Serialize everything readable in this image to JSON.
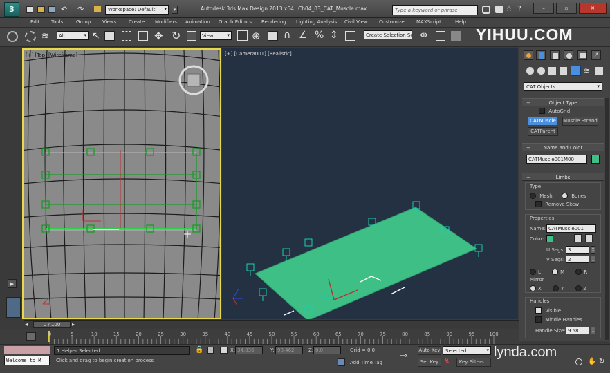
{
  "titlebar": {
    "workspace": "Workspace: Default",
    "title": "Autodesk 3ds Max Design 2013 x64",
    "file": "Ch04_03_CAT_Muscle.max",
    "search_placeholder": "Type a keyword or phrase"
  },
  "menu": [
    "Edit",
    "Tools",
    "Group",
    "Views",
    "Create",
    "Modifiers",
    "Animation",
    "Graph Editors",
    "Rendering",
    "Lighting Analysis",
    "Civil View",
    "Customize",
    "MAXScript",
    "Help"
  ],
  "toolbar": {
    "filter": "All",
    "refcoord": "View",
    "selection_set": "Create Selection Se"
  },
  "viewports": {
    "left_label": "[+] [Top] [Wireframe]",
    "right_label": "[+] [Camera001] [Realistic]"
  },
  "command_panel": {
    "category": "CAT Objects",
    "object_type": {
      "title": "Object Type",
      "autogrid": "AutoGrid",
      "buttons": [
        "CATMuscle",
        "Muscle Strand",
        "CATParent"
      ]
    },
    "name_color": {
      "title": "Name and Color",
      "name": "CATMuscle001M00",
      "color": "#3dbf86"
    },
    "limbs": {
      "title": "Limbs",
      "type_label": "Type",
      "mesh": "Mesh",
      "bones": "Bones",
      "remove_skew": "Remove Skew",
      "properties_label": "Properties",
      "name_label": "Name:",
      "name_value": "CATMuscle001",
      "color_label": "Color:",
      "usegs_label": "U Segs:",
      "usegs_value": "3",
      "vsegs_label": "V Segs:",
      "vsegs_value": "2",
      "lmr": [
        "L",
        "M",
        "R"
      ],
      "mirror_label": "Mirror",
      "xyz": [
        "X",
        "Y",
        "Z"
      ],
      "handles_label": "Handles",
      "visible": "Visible",
      "middle_handles": "Middle Handles",
      "handle_size_label": "Handle Size:",
      "handle_size_value": "9.58"
    }
  },
  "timeline": {
    "frame": "0 / 100",
    "ticks": [
      "0",
      "5",
      "10",
      "15",
      "20",
      "25",
      "30",
      "35",
      "40",
      "45",
      "50",
      "55",
      "60",
      "65",
      "70",
      "75",
      "80",
      "85",
      "90",
      "95",
      "100"
    ]
  },
  "status": {
    "maxscript": "Welcome to M",
    "selected": "1 Helper Selected",
    "prompt": "Click and drag to begin creation process",
    "x_label": "X:",
    "x_value": "34.836",
    "y_label": "Y:",
    "y_value": "98.462",
    "z_label": "Z:",
    "z_value": "0.0",
    "grid": "Grid = 0.0",
    "add_time_tag": "Add Time Tag",
    "auto_key": "Auto Key",
    "set_key": "Set Key",
    "key_mode": "Selected",
    "key_filters": "Key Filters..."
  },
  "watermarks": {
    "top": "YIHUU.COM",
    "bottom": "lynda.com"
  }
}
